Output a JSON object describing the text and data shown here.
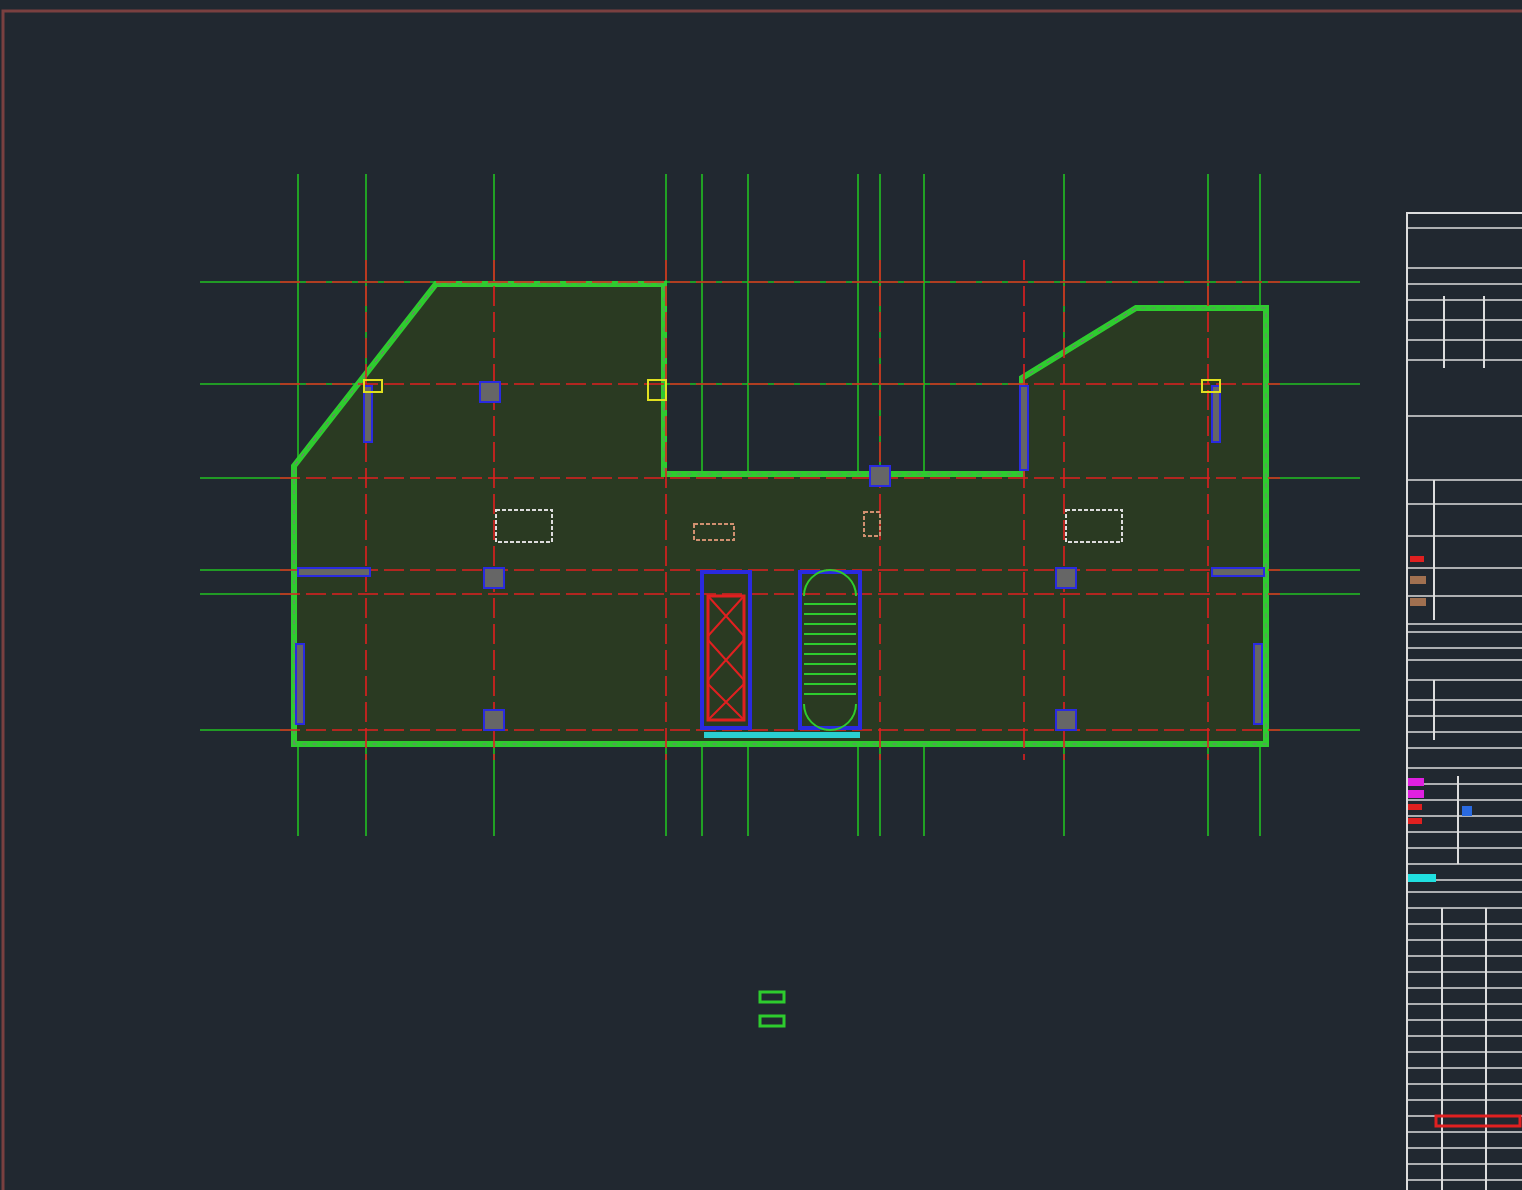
{
  "canvas": {
    "kind": "cad-floor-plan"
  }
}
